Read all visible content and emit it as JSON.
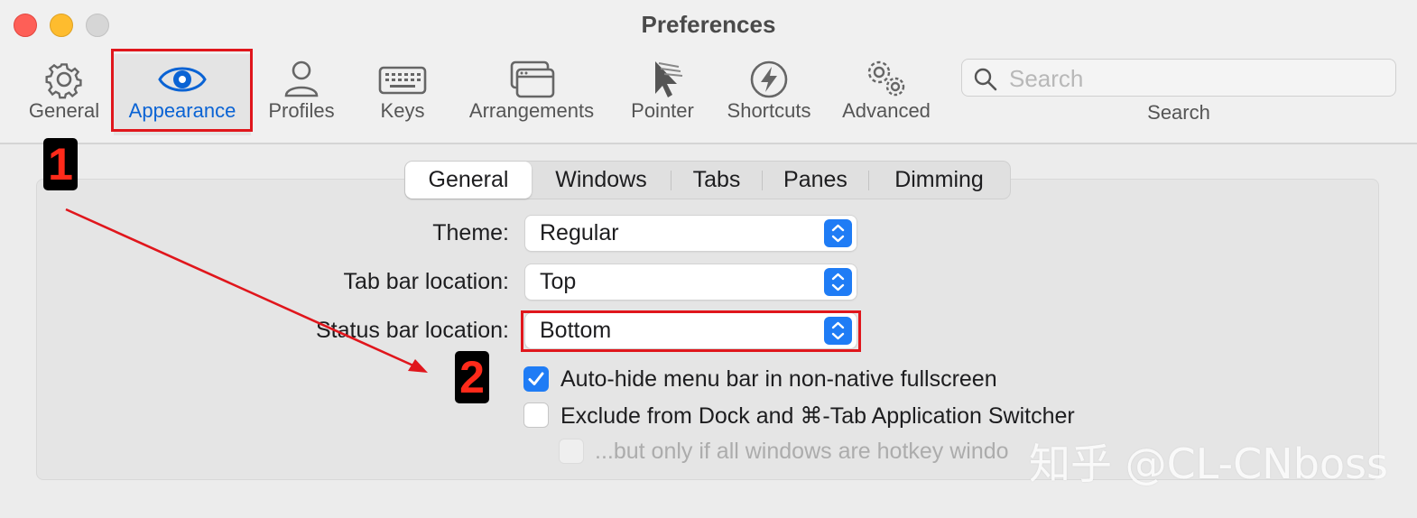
{
  "window": {
    "title": "Preferences"
  },
  "toolbar": {
    "items": [
      {
        "label": "General",
        "icon": "gear-icon"
      },
      {
        "label": "Appearance",
        "icon": "eye-icon",
        "active": true
      },
      {
        "label": "Profiles",
        "icon": "person-icon"
      },
      {
        "label": "Keys",
        "icon": "keyboard-icon"
      },
      {
        "label": "Arrangements",
        "icon": "windows-icon"
      },
      {
        "label": "Pointer",
        "icon": "cursor-icon"
      },
      {
        "label": "Shortcuts",
        "icon": "lightning-icon"
      },
      {
        "label": "Advanced",
        "icon": "gears-icon"
      }
    ],
    "search": {
      "placeholder": "Search",
      "caption": "Search"
    }
  },
  "tabs": {
    "items": [
      "General",
      "Windows",
      "Tabs",
      "Panes",
      "Dimming"
    ],
    "selected": "General"
  },
  "settings": {
    "theme": {
      "label": "Theme:",
      "value": "Regular"
    },
    "tab_bar_location": {
      "label": "Tab bar location:",
      "value": "Top"
    },
    "status_bar_location": {
      "label": "Status bar location:",
      "value": "Bottom"
    },
    "auto_hide_menu_bar": {
      "label": "Auto-hide menu bar in non-native fullscreen",
      "checked": true
    },
    "exclude_from_dock": {
      "label": "Exclude from Dock and ⌘-Tab Application Switcher",
      "checked": false
    },
    "only_hotkey_windows": {
      "label": "...but only if all windows are hotkey windo",
      "checked": false,
      "enabled": false
    }
  },
  "annotations": {
    "badge_1": "1",
    "badge_2": "2",
    "color": "#e0161c"
  },
  "watermark": "知乎 @CL-CNboss",
  "colors": {
    "accent": "#1f7cf5",
    "active_label": "#0a63d4"
  }
}
